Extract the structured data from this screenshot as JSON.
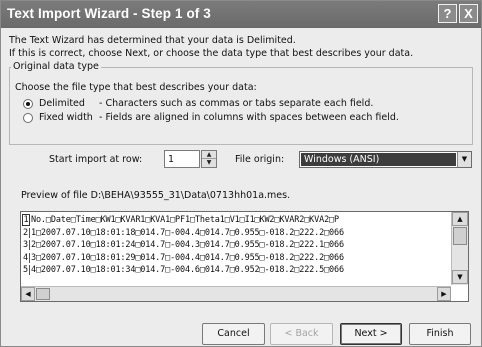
{
  "window": {
    "title": "Text Import Wizard - Step 1 of 3",
    "help_icon": "?",
    "close_icon": "X"
  },
  "intro": {
    "line1": "The Text Wizard has determined that your data is Delimited.",
    "line2": "If this is correct, choose Next, or choose the data type that best describes your data."
  },
  "original_data_type": {
    "legend": "Original data type",
    "prompt": "Choose the file type that best describes your data:",
    "options": [
      {
        "label": "Delimited",
        "description": "- Characters such as commas or tabs separate each field.",
        "selected": true
      },
      {
        "label": "Fixed width",
        "description": "- Fields are aligned in columns with spaces between each field.",
        "selected": false
      }
    ]
  },
  "start_import": {
    "label": "Start import at row:",
    "value": "1"
  },
  "file_origin": {
    "label": "File origin:",
    "value": "Windows (ANSI)"
  },
  "preview": {
    "label": "Preview of file D:\\BEHA\\93555_31\\Data\\0713hh01a.mes.",
    "rows": [
      {
        "num": "1",
        "text": "No.□Date□Time□KW1□KVAR1□KVA1□PF1□Theta1□V1□I1□KW2□KVAR2□KVA2□P"
      },
      {
        "num": "2",
        "text": "1□2007.07.10□18:01:18□014.7□-004.4□014.7□0.955□-018.2□222.2□066"
      },
      {
        "num": "3",
        "text": "2□2007.07.10□18:01:24□014.7□-004.3□014.7□0.955□-018.2□222.1□066"
      },
      {
        "num": "4",
        "text": "3□2007.07.10□18:01:29□014.7□-004.4□014.7□0.955□-018.2□222.2□066"
      },
      {
        "num": "5",
        "text": "4□2007.07.10□18:01:34□014.7□-004.6□014.7□0.952□-018.2□222.5□066"
      }
    ]
  },
  "buttons": {
    "cancel": "Cancel",
    "back": "< Back",
    "next": "Next >",
    "finish": "Finish"
  },
  "colors": {
    "titlebar": "#6f6f6f",
    "dialog_bg": "#ececec",
    "combo_selected": "#3d3d3d"
  }
}
